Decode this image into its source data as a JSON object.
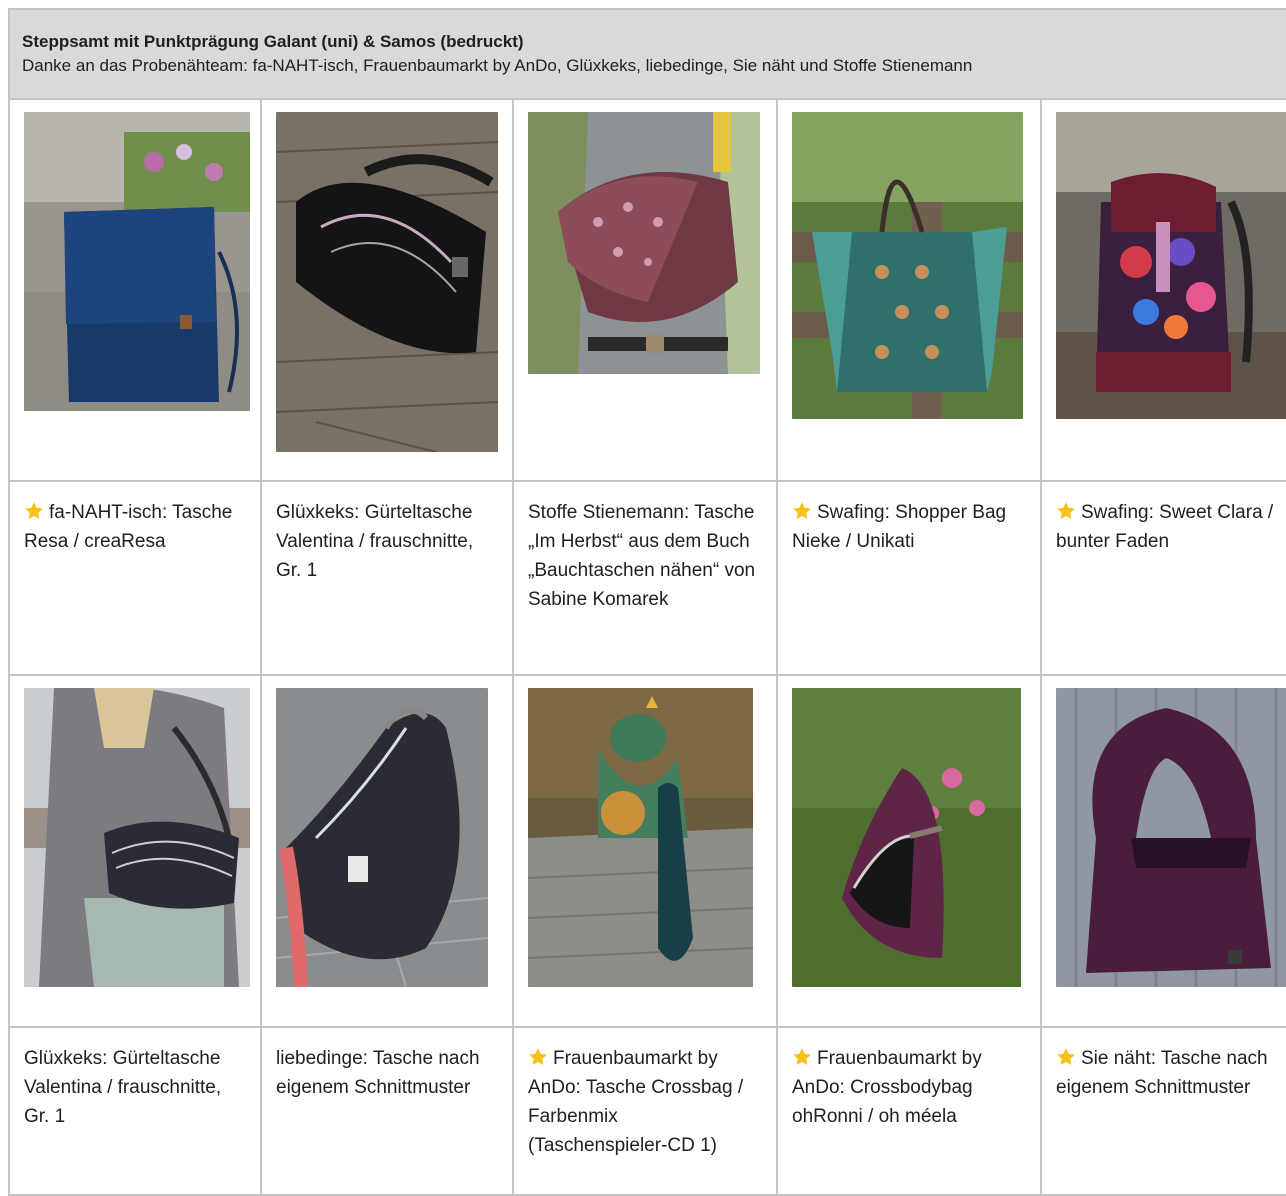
{
  "header": {
    "title": "Steppsamt mit Punktprägung Galant (uni) & Samos (bedruckt)",
    "subtitle": "Danke an das Probenähteam: fa-NAHT-isch, Frauenbaumarkt by AnDo, Glüxkeks, liebedinge, Sie näht und Stoffe Stienemann"
  },
  "colors": {
    "header_bg": "#d9d9d9",
    "grid": "#c4c4c4",
    "star": "#f6c21a"
  },
  "row1": [
    {
      "star": true,
      "caption": "fa-NAHT-isch: Tasche Resa / creaResa",
      "photo": "navy-quilted-bag-photo"
    },
    {
      "star": false,
      "caption": "Glüxkeks: Gürteltasche Valentina / frauschnitte, Gr. 1",
      "photo": "black-belt-bag-photo"
    },
    {
      "star": false,
      "caption": "Stoffe Stienemann: Tasche „Im Herbst“ aus dem Buch „Bauchtaschen nähen“ von Sabine Komarek",
      "photo": "printed-crossbody-photo"
    },
    {
      "star": true,
      "caption": "Swafing: Shopper Bag Nieke / Unikati",
      "photo": "shopper-bag-photo"
    },
    {
      "star": true,
      "caption": "Swafing: Sweet Clara / bunter Faden",
      "photo": "floral-backpack-photo"
    }
  ],
  "row2": [
    {
      "star": false,
      "caption": "Glüxkeks: Gürteltasche Valentina / frauschnitte, Gr. 1",
      "photo": "worn-belt-bag-photo"
    },
    {
      "star": false,
      "caption": "liebedinge: Tasche nach eigenem Schnittmuster",
      "photo": "banana-bag-photo"
    },
    {
      "star": true,
      "caption": "Frauenbaumarkt by AnDo: Tasche Crossbag / Farbenmix (Taschenspieler-CD 1)",
      "photo": "frog-crossbag-photo"
    },
    {
      "star": true,
      "caption": "Frauenbaumarkt by AnDo: Crossbodybag ohRonni / oh méela",
      "photo": "crossbodybag-photo"
    },
    {
      "star": true,
      "caption": "Sie näht: Tasche nach eigenem Schnittmuster",
      "photo": "hobo-bag-photo"
    }
  ]
}
